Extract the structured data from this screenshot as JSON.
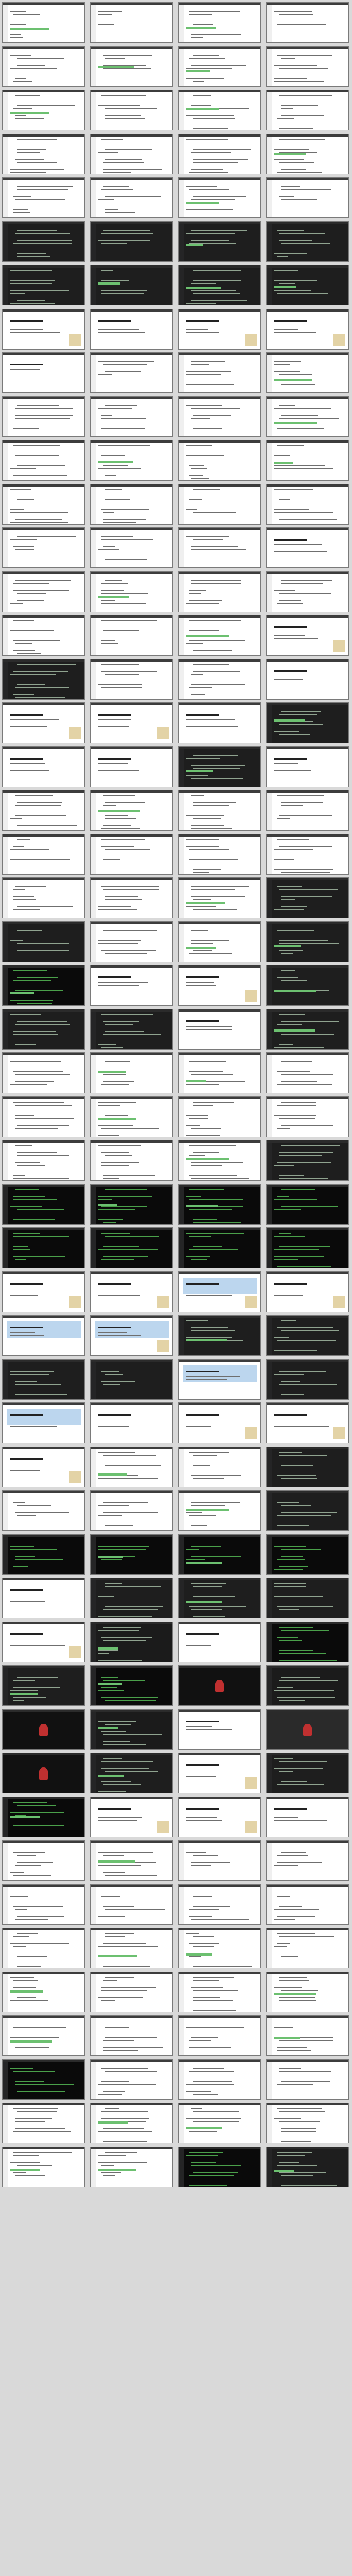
{
  "sheet": {
    "title": "",
    "thumbnail_count": 232
  },
  "frames": [
    {
      "kind": "light"
    },
    {
      "kind": "light"
    },
    {
      "kind": "light"
    },
    {
      "kind": "light"
    },
    {
      "kind": "light"
    },
    {
      "kind": "light"
    },
    {
      "kind": "light"
    },
    {
      "kind": "light"
    },
    {
      "kind": "light"
    },
    {
      "kind": "light"
    },
    {
      "kind": "light"
    },
    {
      "kind": "light"
    },
    {
      "kind": "light"
    },
    {
      "kind": "light"
    },
    {
      "kind": "light"
    },
    {
      "kind": "light"
    },
    {
      "kind": "light"
    },
    {
      "kind": "light"
    },
    {
      "kind": "light"
    },
    {
      "kind": "light"
    },
    {
      "kind": "dark"
    },
    {
      "kind": "dark"
    },
    {
      "kind": "dark"
    },
    {
      "kind": "dark"
    },
    {
      "kind": "dark"
    },
    {
      "kind": "dark"
    },
    {
      "kind": "dark"
    },
    {
      "kind": "dark"
    },
    {
      "kind": "title"
    },
    {
      "kind": "title"
    },
    {
      "kind": "title"
    },
    {
      "kind": "title"
    },
    {
      "kind": "title"
    },
    {
      "kind": "light"
    },
    {
      "kind": "light"
    },
    {
      "kind": "light"
    },
    {
      "kind": "light"
    },
    {
      "kind": "light"
    },
    {
      "kind": "light"
    },
    {
      "kind": "light"
    },
    {
      "kind": "light"
    },
    {
      "kind": "light"
    },
    {
      "kind": "light"
    },
    {
      "kind": "light"
    },
    {
      "kind": "light"
    },
    {
      "kind": "light"
    },
    {
      "kind": "light"
    },
    {
      "kind": "light"
    },
    {
      "kind": "light"
    },
    {
      "kind": "light"
    },
    {
      "kind": "light"
    },
    {
      "kind": "title"
    },
    {
      "kind": "light"
    },
    {
      "kind": "light"
    },
    {
      "kind": "light"
    },
    {
      "kind": "light"
    },
    {
      "kind": "light"
    },
    {
      "kind": "light"
    },
    {
      "kind": "light"
    },
    {
      "kind": "title"
    },
    {
      "kind": "dark"
    },
    {
      "kind": "light"
    },
    {
      "kind": "light"
    },
    {
      "kind": "title"
    },
    {
      "kind": "title"
    },
    {
      "kind": "title"
    },
    {
      "kind": "title"
    },
    {
      "kind": "dark"
    },
    {
      "kind": "title"
    },
    {
      "kind": "title"
    },
    {
      "kind": "dark"
    },
    {
      "kind": "title"
    },
    {
      "kind": "light"
    },
    {
      "kind": "light"
    },
    {
      "kind": "light"
    },
    {
      "kind": "light"
    },
    {
      "kind": "light"
    },
    {
      "kind": "light"
    },
    {
      "kind": "light"
    },
    {
      "kind": "light"
    },
    {
      "kind": "light"
    },
    {
      "kind": "light"
    },
    {
      "kind": "light"
    },
    {
      "kind": "dark"
    },
    {
      "kind": "dark"
    },
    {
      "kind": "light"
    },
    {
      "kind": "light"
    },
    {
      "kind": "dark"
    },
    {
      "kind": "black"
    },
    {
      "kind": "title"
    },
    {
      "kind": "title"
    },
    {
      "kind": "dark"
    },
    {
      "kind": "dark"
    },
    {
      "kind": "dark"
    },
    {
      "kind": "title"
    },
    {
      "kind": "dark"
    },
    {
      "kind": "light"
    },
    {
      "kind": "light"
    },
    {
      "kind": "light"
    },
    {
      "kind": "light"
    },
    {
      "kind": "light"
    },
    {
      "kind": "light"
    },
    {
      "kind": "light"
    },
    {
      "kind": "light"
    },
    {
      "kind": "light"
    },
    {
      "kind": "light"
    },
    {
      "kind": "light"
    },
    {
      "kind": "dark"
    },
    {
      "kind": "black"
    },
    {
      "kind": "black"
    },
    {
      "kind": "black"
    },
    {
      "kind": "black"
    },
    {
      "kind": "black"
    },
    {
      "kind": "black"
    },
    {
      "kind": "black"
    },
    {
      "kind": "black"
    },
    {
      "kind": "title"
    },
    {
      "kind": "title"
    },
    {
      "kind": "blue"
    },
    {
      "kind": "title"
    },
    {
      "kind": "blue"
    },
    {
      "kind": "blue"
    },
    {
      "kind": "dark"
    },
    {
      "kind": "dark"
    },
    {
      "kind": "dark"
    },
    {
      "kind": "dark"
    },
    {
      "kind": "blue"
    },
    {
      "kind": "dark"
    },
    {
      "kind": "blue"
    },
    {
      "kind": "title"
    },
    {
      "kind": "title"
    },
    {
      "kind": "title"
    },
    {
      "kind": "title"
    },
    {
      "kind": "light"
    },
    {
      "kind": "light"
    },
    {
      "kind": "dark"
    },
    {
      "kind": "light"
    },
    {
      "kind": "light"
    },
    {
      "kind": "light"
    },
    {
      "kind": "dark"
    },
    {
      "kind": "black"
    },
    {
      "kind": "black"
    },
    {
      "kind": "black"
    },
    {
      "kind": "black"
    },
    {
      "kind": "title"
    },
    {
      "kind": "dark"
    },
    {
      "kind": "dark"
    },
    {
      "kind": "dark"
    },
    {
      "kind": "title"
    },
    {
      "kind": "tiles"
    },
    {
      "kind": "title"
    },
    {
      "kind": "black"
    },
    {
      "kind": "dark"
    },
    {
      "kind": "black"
    },
    {
      "kind": "video"
    },
    {
      "kind": "tiles"
    },
    {
      "kind": "video"
    },
    {
      "kind": "tiles"
    },
    {
      "kind": "title"
    },
    {
      "kind": "splash"
    },
    {
      "kind": "video"
    },
    {
      "kind": "dark"
    },
    {
      "kind": "title"
    },
    {
      "kind": "dark"
    },
    {
      "kind": "black"
    },
    {
      "kind": "title"
    },
    {
      "kind": "title"
    },
    {
      "kind": "title"
    },
    {
      "kind": "light"
    },
    {
      "kind": "light"
    },
    {
      "kind": "light"
    },
    {
      "kind": "light"
    },
    {
      "kind": "light"
    },
    {
      "kind": "light"
    },
    {
      "kind": "light"
    },
    {
      "kind": "light"
    },
    {
      "kind": "light"
    },
    {
      "kind": "light"
    },
    {
      "kind": "light"
    },
    {
      "kind": "light"
    },
    {
      "kind": "light"
    },
    {
      "kind": "light"
    },
    {
      "kind": "light"
    },
    {
      "kind": "light"
    },
    {
      "kind": "light"
    },
    {
      "kind": "light"
    },
    {
      "kind": "light"
    },
    {
      "kind": "light"
    },
    {
      "kind": "black"
    },
    {
      "kind": "light"
    },
    {
      "kind": "light"
    },
    {
      "kind": "light"
    },
    {
      "kind": "light"
    },
    {
      "kind": "light"
    },
    {
      "kind": "light"
    },
    {
      "kind": "light"
    },
    {
      "kind": "light"
    },
    {
      "kind": "light"
    },
    {
      "kind": "black"
    },
    {
      "kind": "dark"
    }
  ],
  "colors": {
    "page_bg": "#d9d9d9",
    "light_bg": "#ffffff",
    "dark_bg": "#1e1e1e",
    "code_green": "#6cc070",
    "accent_red": "#c03030",
    "note_tan": "#e3d3a6"
  }
}
